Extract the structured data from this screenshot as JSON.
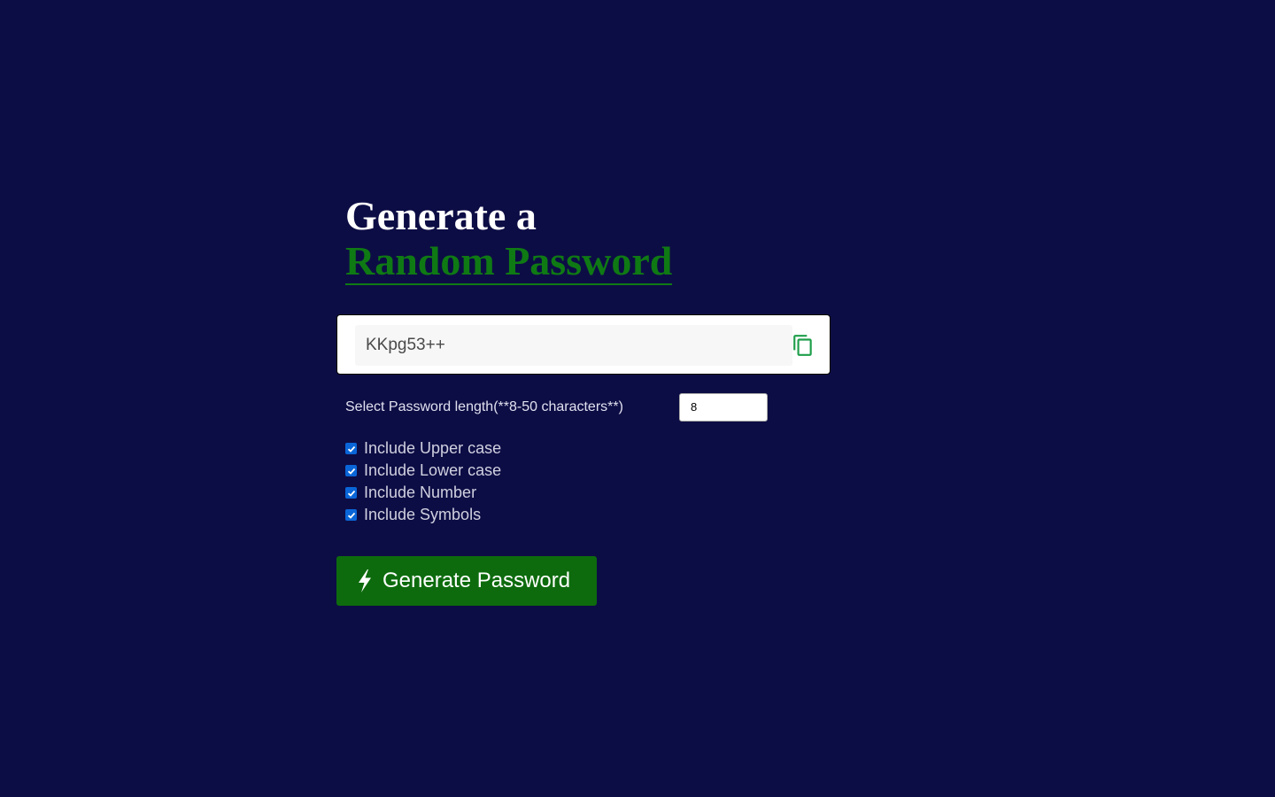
{
  "heading": {
    "line1": "Generate a",
    "line2": "Random Password"
  },
  "password": {
    "value": "KKpg53++"
  },
  "length": {
    "label": "Select Password length(**8-50 characters**)",
    "value": "8"
  },
  "options": [
    {
      "label": "Include Upper case",
      "checked": true
    },
    {
      "label": "Include Lower case",
      "checked": true
    },
    {
      "label": "Include Number",
      "checked": true
    },
    {
      "label": "Include Symbols",
      "checked": true
    }
  ],
  "generate_button": {
    "label": "Generate Password"
  },
  "icons": {
    "copy": "copy-icon",
    "generate": "bolt-icon"
  },
  "colors": {
    "background": "#0d0d45",
    "accent_green": "#0f7a14",
    "button_green": "#0d6b0d",
    "checkbox_blue": "#0a66d8"
  }
}
